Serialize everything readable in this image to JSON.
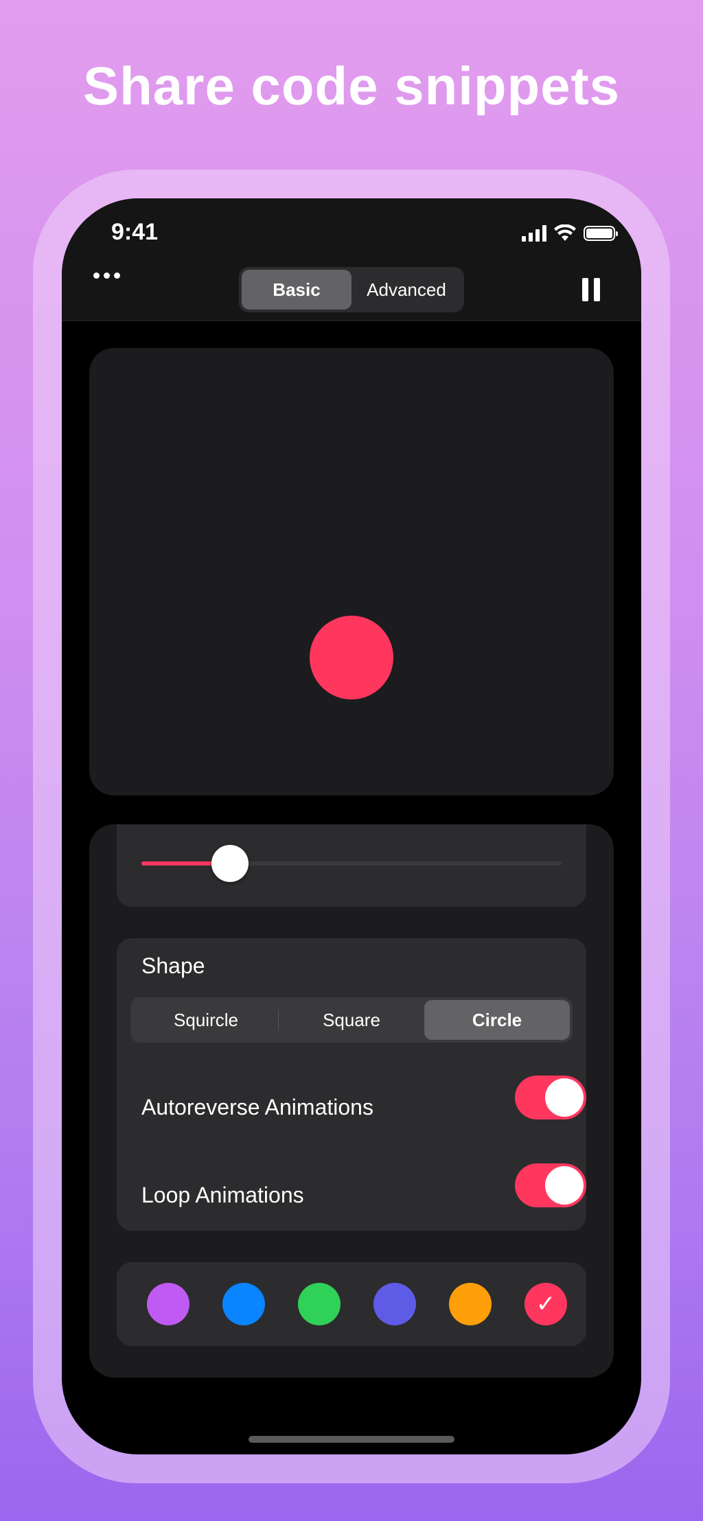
{
  "headline": "Share code snippets",
  "status_bar": {
    "time": "9:41"
  },
  "nav": {
    "tabs": [
      {
        "label": "Basic",
        "selected": true
      },
      {
        "label": "Advanced",
        "selected": false
      }
    ]
  },
  "preview": {
    "ball_color": "#ff375f"
  },
  "slider": {
    "value_fraction": 0.21,
    "accent": "#ff375f"
  },
  "shape": {
    "title": "Shape",
    "options": [
      {
        "label": "Squircle",
        "selected": false
      },
      {
        "label": "Square",
        "selected": false
      },
      {
        "label": "Circle",
        "selected": true
      }
    ]
  },
  "toggles": [
    {
      "label": "Autoreverse Animations",
      "on": true
    },
    {
      "label": "Loop Animations",
      "on": true
    }
  ],
  "colors": [
    {
      "name": "purple",
      "hex": "#bf5af2",
      "selected": false
    },
    {
      "name": "blue",
      "hex": "#0a84ff",
      "selected": false
    },
    {
      "name": "green",
      "hex": "#30d158",
      "selected": false
    },
    {
      "name": "indigo",
      "hex": "#5e5ce6",
      "selected": false
    },
    {
      "name": "orange",
      "hex": "#ff9f0a",
      "selected": false
    },
    {
      "name": "pink",
      "hex": "#ff375f",
      "selected": true
    }
  ],
  "icons": {
    "more": "more-icon",
    "pause": "pause-icon",
    "check": "✓"
  }
}
